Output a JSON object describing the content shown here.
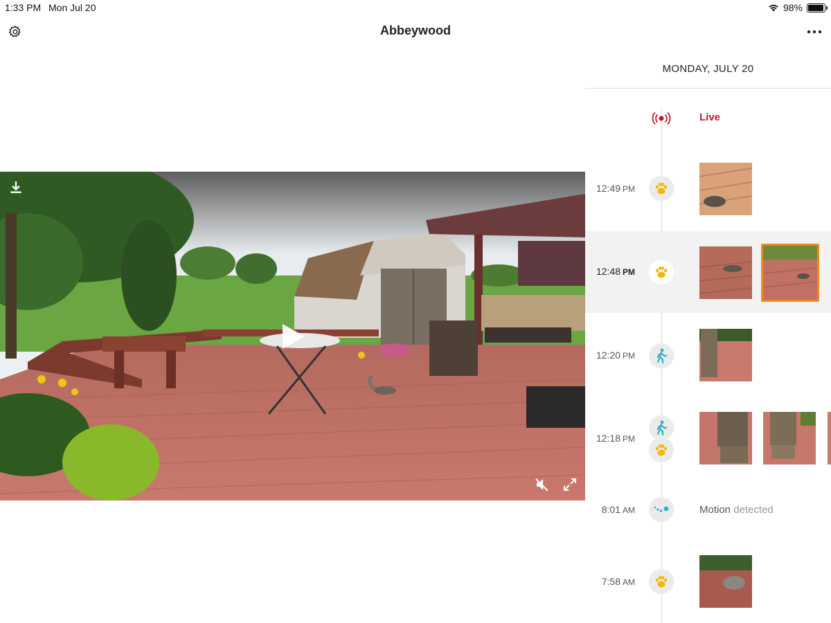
{
  "status_bar": {
    "time": "1:33 PM",
    "date": "Mon Jul 20",
    "battery": "98%",
    "battery_level": 0.98
  },
  "nav": {
    "title": "Abbeywood",
    "settings_icon": "gear-icon",
    "more_icon": "ellipsis-icon"
  },
  "video": {
    "download_icon": "download-icon",
    "play_icon": "play-icon",
    "mute_icon": "speaker-muted-icon",
    "fullscreen_icon": "expand-icon"
  },
  "timeline": {
    "date_header": "MONDAY, JULY 20",
    "live": {
      "label": "Live",
      "icon": "live-broadcast-icon",
      "color": "#c2172f"
    },
    "events": [
      {
        "time": "12:49",
        "ampm": "PM",
        "icon": "paw-icon",
        "thumbs": 1,
        "selected": false
      },
      {
        "time": "12:48",
        "ampm": "PM",
        "icon": "paw-icon",
        "thumbs": 2,
        "selected": true
      },
      {
        "time": "12:20",
        "ampm": "PM",
        "icon": "person-walking-icon",
        "thumbs": 1,
        "selected": false
      },
      {
        "time": "12:18",
        "ampm": "PM",
        "icon": "person-walking-icon",
        "icon2": "paw-icon",
        "thumbs": 3,
        "selected": false
      },
      {
        "time": "8:01",
        "ampm": "AM",
        "icon": "motion-dots-icon",
        "label_strong": "Motion",
        "label_muted": "detected",
        "selected": false
      },
      {
        "time": "7:58",
        "ampm": "AM",
        "icon": "paw-icon",
        "thumbs": 1,
        "selected": false
      }
    ]
  },
  "colors": {
    "accent_orange": "#ef8a1d",
    "paw_yellow": "#f5b700",
    "person_teal": "#2bb3c6",
    "live_red": "#c2172f"
  }
}
